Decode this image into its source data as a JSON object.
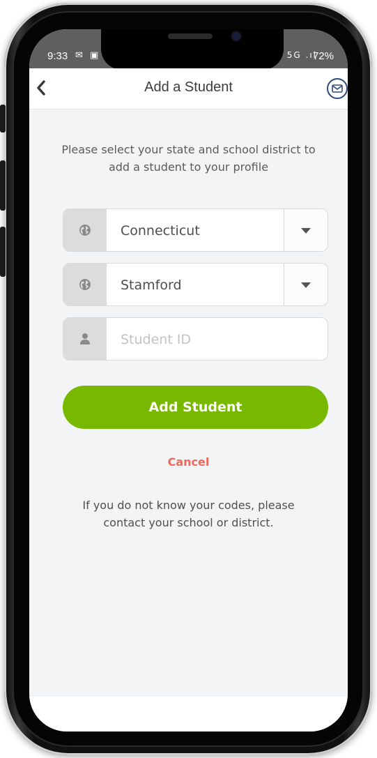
{
  "status_bar": {
    "time": "9:33",
    "left_icons": "✉ ▣ ♁",
    "right_icons": "⏰ ✕ ⇡ 5G .ıl",
    "battery": "72%"
  },
  "header": {
    "back_icon": "chevron-left-icon",
    "title": "Add a Student",
    "mail_icon": "envelope-icon"
  },
  "intro_text": "Please select your state and school district to add a student to your profile",
  "form": {
    "state": {
      "icon": "globe-icon",
      "value": "Connecticut"
    },
    "district": {
      "icon": "globe-icon",
      "value": "Stamford"
    },
    "student_id": {
      "icon": "person-icon",
      "placeholder": "Student ID",
      "value": ""
    }
  },
  "add_button_label": "Add Student",
  "cancel_label": "Cancel",
  "help_text": "If you do not know your codes, please contact your school or district.",
  "colors": {
    "accent_green": "#79b800",
    "cancel_red": "#ee6a5f",
    "background": "#f3f4f6",
    "status_bar": "#5f5f5f"
  }
}
